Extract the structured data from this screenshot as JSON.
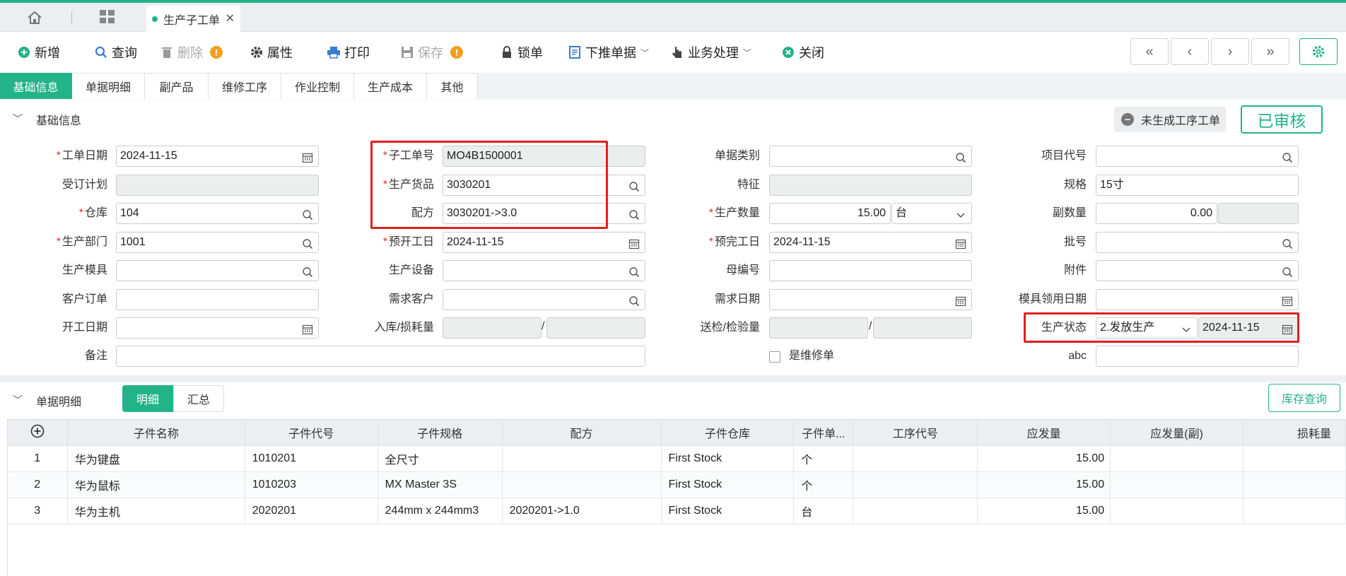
{
  "tabbar": {
    "doc_tab": "生产子工单",
    "close": "✕"
  },
  "toolbar": {
    "add": "新增",
    "query": "查询",
    "delete": "删除",
    "properties": "属性",
    "print": "打印",
    "save": "保存",
    "lock": "锁单",
    "push_down": "下推单据",
    "business": "业务处理",
    "close": "关闭",
    "warn_mark": "!"
  },
  "section_tabs": [
    "基础信息",
    "单据明细",
    "副产品",
    "维修工序",
    "作业控制",
    "生产成本",
    "其他"
  ],
  "basic": {
    "title": "基础信息",
    "not_generated": "未生成工序工单",
    "approved": "已审核",
    "labels": {
      "order_date": "工单日期",
      "sub_order_no": "子工单号",
      "doc_type": "单据类别",
      "project_code": "项目代号",
      "subscription_plan": "受订计划",
      "product": "生产货品",
      "feature": "特征",
      "spec": "规格",
      "warehouse": "仓库",
      "formula": "配方",
      "quantity": "生产数量",
      "sub_qty": "副数量",
      "dept": "生产部门",
      "plan_start": "预开工日",
      "plan_end": "预完工日",
      "batch": "批号",
      "mold": "生产模具",
      "equipment": "生产设备",
      "parent_no": "母编号",
      "attachment": "附件",
      "customer_order": "客户订单",
      "demand_customer": "需求客户",
      "demand_date": "需求日期",
      "mold_date": "模具领用日期",
      "start_date": "开工日期",
      "in_loss": "入库/损耗量",
      "inspect_qty": "送检/检验量",
      "status": "生产状态",
      "remark": "备注",
      "is_repair": "是维修单",
      "abc": "abc"
    },
    "values": {
      "order_date": "2024-11-15",
      "sub_order_no": "MO4B1500001",
      "product": "3030201",
      "spec": "15寸",
      "warehouse": "104",
      "formula": "3030201->3.0",
      "quantity": "15.00",
      "unit": "台",
      "sub_qty": "0.00",
      "dept": "1001",
      "plan_start": "2024-11-15",
      "plan_end": "2024-11-15",
      "status": "2.发放生产",
      "status_date": "2024-11-15",
      "slash": "/"
    }
  },
  "detail": {
    "title": "单据明细",
    "tab_detail": "明细",
    "tab_summary": "汇总",
    "stock_query": "库存查询",
    "columns": [
      "子件名称",
      "子件代号",
      "子件规格",
      "配方",
      "子件仓库",
      "子件单...",
      "工序代号",
      "应发量",
      "应发量(副)",
      "损耗量"
    ],
    "rows": [
      [
        "1",
        "华为键盘",
        "1010201",
        "全尺寸",
        "",
        "First Stock",
        "个",
        "",
        "15.00",
        "",
        ""
      ],
      [
        "2",
        "华为鼠标",
        "1010203",
        "MX Master 3S",
        "",
        "First Stock",
        "个",
        "",
        "15.00",
        "",
        ""
      ],
      [
        "3",
        "华为主机",
        "2020201",
        "244mm x 244mm3",
        "2020201->1.0",
        "First Stock",
        "台",
        "",
        "15.00",
        "",
        ""
      ]
    ]
  },
  "colors": {
    "accent": "#23b389",
    "required": "#e03030",
    "highlight": "#e02020"
  }
}
